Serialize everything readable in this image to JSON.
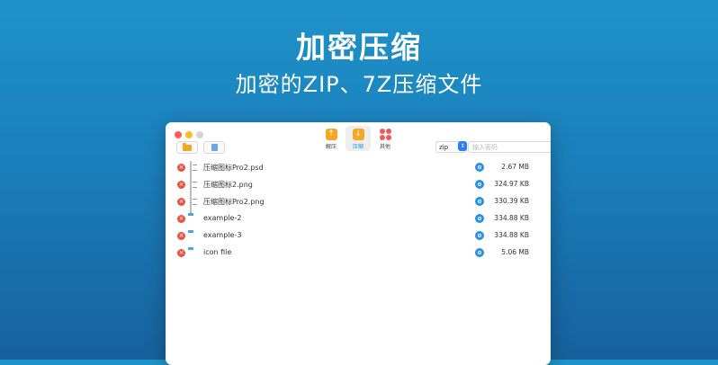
{
  "hero": {
    "title": "加密压缩",
    "subtitle": "加密的ZIP、7Z压缩文件"
  },
  "window": {
    "toolbar": {
      "tools": [
        {
          "label": "解压",
          "icon": "extract-arrow-up-icon",
          "active": false
        },
        {
          "label": "压缩",
          "icon": "compress-arrow-down-icon",
          "active": true
        },
        {
          "label": "其他",
          "icon": "grid-dots-icon",
          "active": false
        }
      ],
      "format_select": {
        "value": "zip"
      },
      "password": {
        "placeholder": "输入密码",
        "value": ""
      }
    },
    "files": [
      {
        "name": "压缩图标Pro2.psd",
        "type": "file",
        "size": "2.67 MB"
      },
      {
        "name": "压缩图标2.png",
        "type": "file",
        "size": "324.97 KB"
      },
      {
        "name": "压缩图标Pro2.png",
        "type": "file",
        "size": "330.39 KB"
      },
      {
        "name": "example-2",
        "type": "folder",
        "size": "334.88 KB"
      },
      {
        "name": "example-3",
        "type": "folder",
        "size": "334.88 KB"
      },
      {
        "name": "icon file",
        "type": "folder",
        "size": "5.06 MB"
      }
    ]
  },
  "colors": {
    "background_top": "#1e93c9",
    "background_bottom": "#17619d",
    "accent_blue": "#2b7ff0",
    "remove_red": "#e8533f",
    "tool_orange": "#f6a623",
    "folder_blue": "#5fb4ef"
  }
}
